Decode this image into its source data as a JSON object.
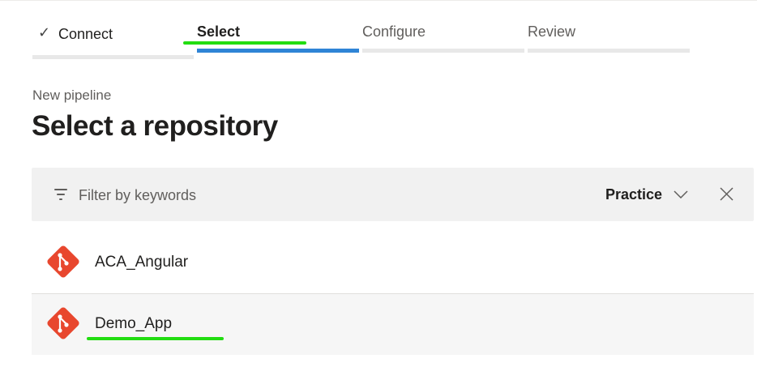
{
  "stepper": {
    "steps": [
      {
        "label": "Connect",
        "state": "done",
        "check": "✓"
      },
      {
        "label": "Select",
        "state": "active"
      },
      {
        "label": "Configure",
        "state": "pending"
      },
      {
        "label": "Review",
        "state": "pending"
      }
    ]
  },
  "breadcrumb": "New pipeline",
  "title": "Select a repository",
  "filter": {
    "placeholder": "Filter by keywords",
    "organization": "Practice",
    "icon": "filter-icon"
  },
  "repositories": [
    {
      "name": "ACA_Angular",
      "icon": "git-repo-icon"
    },
    {
      "name": "Demo_App",
      "icon": "git-repo-icon"
    }
  ],
  "colors": {
    "active_step": "#2f84d6",
    "git_icon": "#e8472e",
    "annotation": "#22dd11"
  }
}
